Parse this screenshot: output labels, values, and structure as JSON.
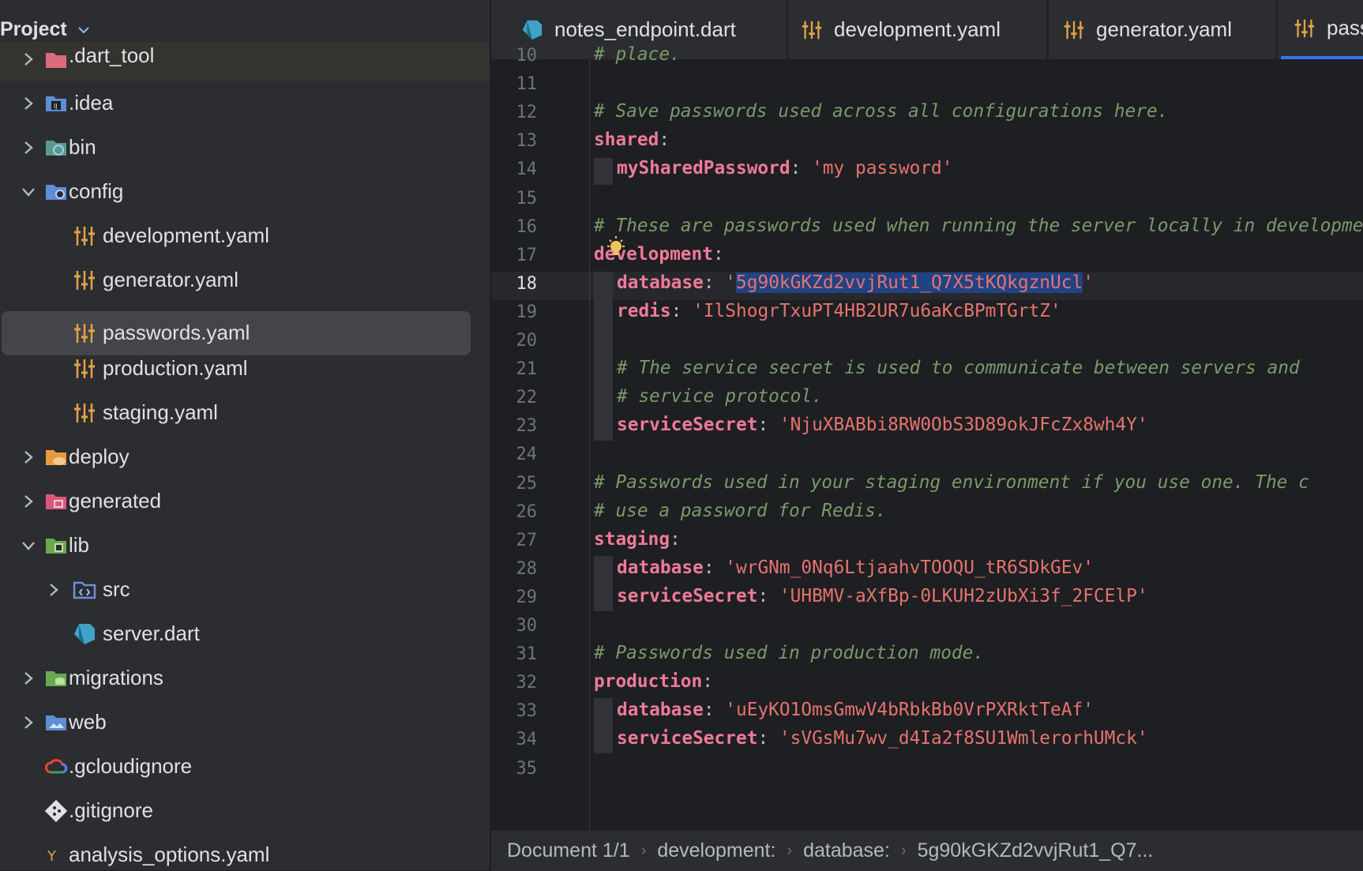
{
  "sidebar": {
    "title": "Project",
    "items": [
      {
        "label": ".dart_tool",
        "icon": "folder-excluded-icon"
      },
      {
        "label": ".idea",
        "icon": "idea-folder-icon"
      },
      {
        "label": "bin",
        "icon": "source-folder-icon"
      },
      {
        "label": "config",
        "icon": "config-folder-icon"
      },
      {
        "label": "development.yaml",
        "icon": "yaml-file-icon"
      },
      {
        "label": "generator.yaml",
        "icon": "yaml-file-icon"
      },
      {
        "label": "passwords.yaml",
        "icon": "yaml-file-icon"
      },
      {
        "label": "production.yaml",
        "icon": "yaml-file-icon"
      },
      {
        "label": "staging.yaml",
        "icon": "yaml-file-icon"
      },
      {
        "label": "deploy",
        "icon": "folder-icon"
      },
      {
        "label": "generated",
        "icon": "generated-folder-icon"
      },
      {
        "label": "lib",
        "icon": "lib-folder-icon"
      },
      {
        "label": "src",
        "icon": "code-folder-icon"
      },
      {
        "label": "server.dart",
        "icon": "dart-file-icon"
      },
      {
        "label": "migrations",
        "icon": "database-folder-icon"
      },
      {
        "label": "web",
        "icon": "folder-icon"
      },
      {
        "label": ".gcloudignore",
        "icon": "gcloud-icon"
      },
      {
        "label": ".gitignore",
        "icon": "git-icon"
      },
      {
        "label": "analysis_options.yaml",
        "icon": "yaml-file-icon"
      }
    ]
  },
  "tabs": [
    {
      "label": "notes_endpoint.dart",
      "icon": "dart-file-icon"
    },
    {
      "label": "development.yaml",
      "icon": "yaml-file-icon"
    },
    {
      "label": "generator.yaml",
      "icon": "yaml-file-icon"
    },
    {
      "label": "passwords.yaml",
      "icon": "yaml-file-icon"
    }
  ],
  "editor": {
    "current_line": 18,
    "lines": [
      {
        "n": "10",
        "t": "# place."
      },
      {
        "n": "11",
        "t": ""
      },
      {
        "n": "12",
        "t": "# Save passwords used across all configurations here."
      },
      {
        "n": "13",
        "k": "shared"
      },
      {
        "n": "14",
        "k": "mySharedPassword",
        "v": "'my password'"
      },
      {
        "n": "15",
        "t": ""
      },
      {
        "n": "16",
        "t": "# These are passwords used when running the server locally in development."
      },
      {
        "n": "17",
        "k": "development"
      },
      {
        "n": "18",
        "k": "database",
        "v_pre": "'",
        "v_sel": "5g90kGKZd2vvjRut1_Q7X5tKQkgznUcl",
        "v_post": "'"
      },
      {
        "n": "19",
        "k": "redis",
        "v": "'IlShogrTxuPT4HB2UR7u6aKcBPmTGrtZ'"
      },
      {
        "n": "20",
        "t": ""
      },
      {
        "n": "21",
        "t": "# The service secret is used to communicate between servers and"
      },
      {
        "n": "22",
        "t": "# service protocol."
      },
      {
        "n": "23",
        "k": "serviceSecret",
        "v": "'NjuXBABbi8RW0ObS3D89okJFcZx8wh4Y'"
      },
      {
        "n": "24",
        "t": ""
      },
      {
        "n": "25",
        "t": "# Passwords used in your staging environment if you use one. The c"
      },
      {
        "n": "26",
        "t": "# use a password for Redis."
      },
      {
        "n": "27",
        "k": "staging"
      },
      {
        "n": "28",
        "k": "database",
        "v": "'wrGNm_0Nq6LtjaahvTOOQU_tR6SDkGEv'"
      },
      {
        "n": "29",
        "k": "serviceSecret",
        "v": "'UHBMV-aXfBp-0LKUH2zUbXi3f_2FCElP'"
      },
      {
        "n": "30",
        "t": ""
      },
      {
        "n": "31",
        "t": "# Passwords used in production mode."
      },
      {
        "n": "32",
        "k": "production"
      },
      {
        "n": "33",
        "k": "database",
        "v": "'uEyKO1OmsGmwV4bRbkBb0VrPXRktTeAf'"
      },
      {
        "n": "34",
        "k": "serviceSecret",
        "v": "'sVGsMu7wv_d4Ia2f8SU1WmlerorhUMck'"
      },
      {
        "n": "35",
        "t": ""
      }
    ],
    "colon": ":"
  },
  "breadcrumb": {
    "items": [
      "Document 1/1",
      "development:",
      "database:",
      "5g90kGKZd2vvjRut1_Q7..."
    ]
  },
  "colors": {
    "comment": "#7a9a6a",
    "key": "#f07a9a",
    "string": "#e6736f",
    "selection": "#214283",
    "accent": "#3574f0"
  }
}
